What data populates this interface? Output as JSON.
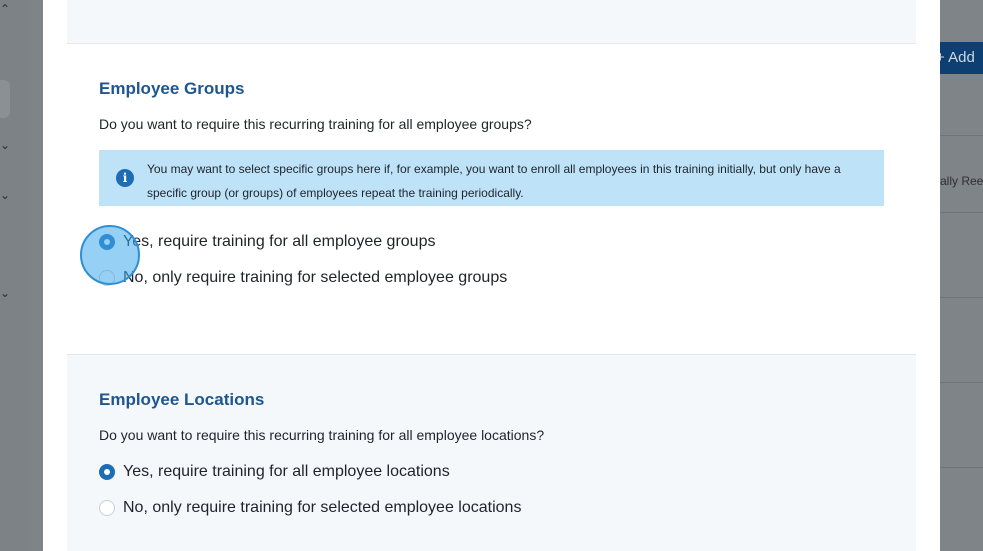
{
  "background": {
    "add_button_label": "+ Add",
    "table_cell_text": "ally Ree"
  },
  "modal": {
    "groups": {
      "title": "Employee Groups",
      "question": "Do you want to require this recurring training for all employee groups?",
      "info_icon": "info-icon",
      "info_text": "You may want to select specific groups here if, for example, you want to enroll all employees in this training initially, but only have a specific group (or groups) of employees repeat the training periodically.",
      "options": [
        {
          "label": "Yes, require training for all employee groups",
          "selected": true
        },
        {
          "label": "No, only require training for selected employee groups",
          "selected": false
        }
      ]
    },
    "locations": {
      "title": "Employee Locations",
      "question": "Do you want to require this recurring training for all employee locations?",
      "options": [
        {
          "label": "Yes, require training for all employee locations",
          "selected": true
        },
        {
          "label": "No, only require training for selected employee locations",
          "selected": false
        }
      ]
    }
  },
  "colors": {
    "accent": "#1d6db5",
    "heading": "#20568f",
    "info_background": "#bee2f8",
    "click_marker": "#40aaeb"
  }
}
